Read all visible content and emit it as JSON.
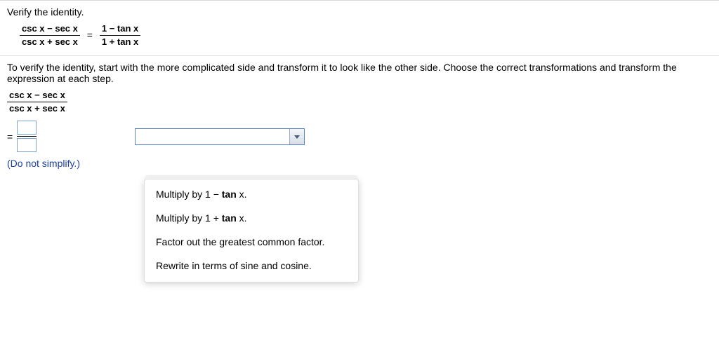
{
  "header": {
    "instruction": "Verify the identity."
  },
  "identity": {
    "left_num": "csc x − sec x",
    "left_den": "csc x + sec x",
    "right_num": "1 − tan x",
    "right_den": "1 + tan x"
  },
  "directions": "To verify the identity, start with the more complicated side and transform it to look like the other side. Choose the correct transformations and transform the expression at each step.",
  "start": {
    "num": "csc x − sec x",
    "den": "csc x + sec x"
  },
  "step": {
    "equals": "=",
    "dropdown_value": ""
  },
  "note": "(Do not simplify.)",
  "options": {
    "items": [
      {
        "pre": "Multiply by 1 − ",
        "bold": "tan",
        "post": " x."
      },
      {
        "pre": "Multiply by 1 + ",
        "bold": "tan",
        "post": " x."
      },
      {
        "pre": "Factor out the greatest common factor.",
        "bold": "",
        "post": ""
      },
      {
        "pre": "Rewrite in terms of sine and cosine.",
        "bold": "",
        "post": ""
      }
    ]
  }
}
